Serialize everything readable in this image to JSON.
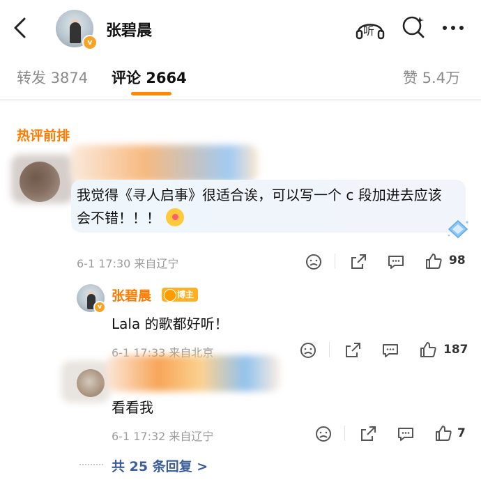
{
  "header": {
    "author_name": "张碧晨",
    "verified_mark": "v",
    "icons": [
      "back-icon",
      "listen-icon",
      "search-icon",
      "more-icon"
    ],
    "listen_label": "听"
  },
  "tabs": {
    "repost": "转发 3874",
    "comments": "评论 2664",
    "likes": "赞 5.4万",
    "accent_color": "#ff8a00"
  },
  "section_title": "热评前排",
  "comments": [
    {
      "text": "我觉得《寻人启事》很适合诶，可以写一个 c 段加进去应该会不错！！！",
      "time_location": "6-1 17:30 来自辽宁",
      "likes": "98"
    }
  ],
  "replies": [
    {
      "name": "张碧晨",
      "badge": "博主",
      "text": "Lala 的歌都好听！",
      "time_location": "6-1 17:33 来自北京",
      "likes": "187"
    },
    {
      "text": "看看我",
      "time_location": "6-1 17:32 来自辽宁",
      "likes": "7"
    }
  ],
  "more_replies": "共 25 条回复 >",
  "colors": {
    "hot_label": "#ff7a00",
    "reply_name": "#ff7a00",
    "link": "#3b5d9c",
    "bubble": "#eef6fc"
  }
}
